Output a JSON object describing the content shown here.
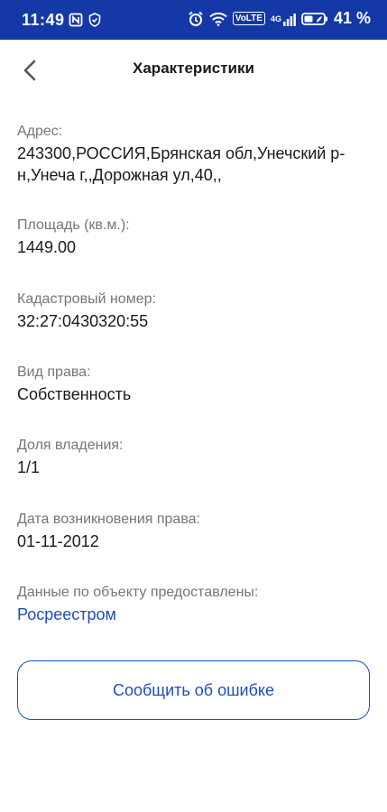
{
  "status_bar": {
    "time": "11:49",
    "volte": "VoLTE",
    "network": "4G",
    "battery": "41 %"
  },
  "header": {
    "title": "Характеристики"
  },
  "fields": [
    {
      "label": "Адрес:",
      "value": "243300,РОССИЯ,Брянская обл,Унечский р-н,Унеча г,,Дорожная ул,40,,"
    },
    {
      "label": "Площадь (кв.м.):",
      "value": "1449.00"
    },
    {
      "label": "Кадастровый номер:",
      "value": "32:27:0430320:55"
    },
    {
      "label": "Вид права:",
      "value": "Собственность"
    },
    {
      "label": "Доля владения:",
      "value": "1/1"
    },
    {
      "label": "Дата возникновения права:",
      "value": "01-11-2012"
    },
    {
      "label": "Данные по объекту предоставлены:",
      "value": "Росреестром"
    }
  ],
  "report_button": "Сообщить об ошибке",
  "colors": {
    "status_bar": "#1438a6",
    "accent": "#1c4fb8",
    "label": "#757575"
  }
}
